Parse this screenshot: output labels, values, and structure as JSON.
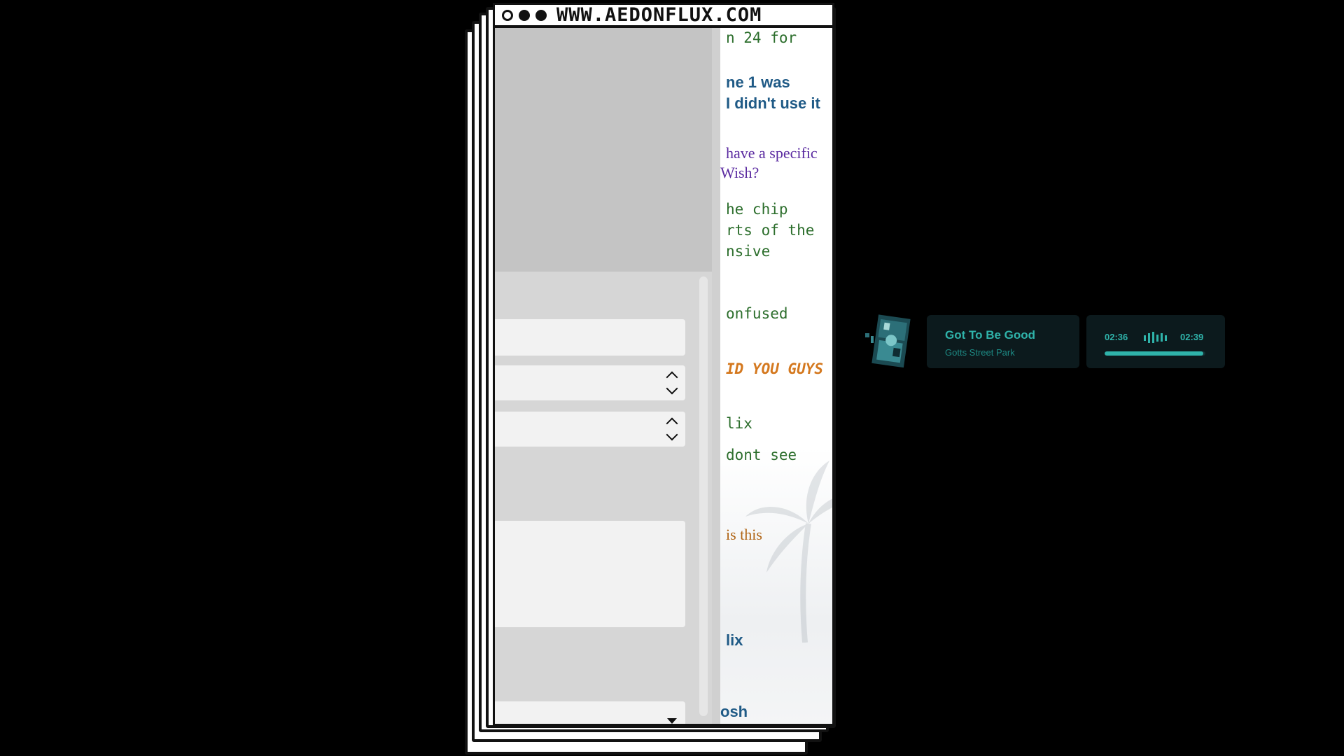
{
  "browser": {
    "url": "WWW.AEDONFLUX.COM"
  },
  "chat": {
    "lines": [
      {
        "text": "n 24 for",
        "color": "#2c6e2c"
      },
      {
        "text": "ne 1 was",
        "color": "#1f5a86"
      },
      {
        "text": "I didn't use it",
        "color": "#1f5a86"
      },
      {
        "text": "have a specific",
        "color": "#5a2aa0"
      },
      {
        "text": "Wish?",
        "color": "#5a2aa0"
      },
      {
        "text": "he chip",
        "color": "#2c6e2c"
      },
      {
        "text": "rts of the",
        "color": "#2c6e2c"
      },
      {
        "text": "nsive",
        "color": "#2c6e2c"
      },
      {
        "text": "onfused",
        "color": "#2c6e2c"
      },
      {
        "text": "ID YOU GUYS",
        "color": "#d4781e"
      },
      {
        "text": "lix",
        "color": "#2c6e2c"
      },
      {
        "text": "dont see",
        "color": "#2c6e2c"
      },
      {
        "text": "is this",
        "color": "#b06414"
      },
      {
        "text": "lix",
        "color": "#1f5a86"
      },
      {
        "text": "osh",
        "color": "#1f5a86"
      }
    ]
  },
  "player": {
    "title": "Got To Be Good",
    "artist": "Gotts Street Park",
    "elapsed": "02:36",
    "duration": "02:39",
    "progress_fraction": 0.98,
    "accent_color": "#2fb3aa"
  },
  "icons": {
    "spin_up": "chevron-up-icon",
    "spin_down": "chevron-down-icon",
    "select_arrow": "triangle-down-icon",
    "equalizer": "equalizer-icon"
  }
}
